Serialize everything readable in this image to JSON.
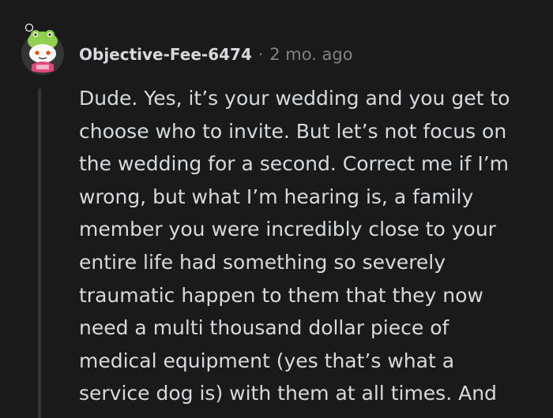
{
  "comment": {
    "author": "Objective-Fee-6474",
    "separator": "·",
    "time": "2 mo. ago",
    "body_lines": [
      "Dude. Yes, it’s your wedding and you get to",
      "choose who to invite. But let’s not focus on",
      "the wedding for a second. Correct me if I’m",
      "wrong, but what I’m hearing is, a family",
      "member you were incredibly close to your",
      "entire life had something so severely",
      "traumatic happen to them that they now",
      "need a multi thousand dollar piece of",
      "medical equipment (yes that’s what a",
      "service dog is) with them at all times. And"
    ]
  },
  "icons": {
    "avatar": "snoo-avatar-green-frog-hat"
  },
  "colors": {
    "background": "#1a1a1b",
    "text": "#d7dadc",
    "muted": "#818384",
    "thread_line": "#343536"
  }
}
